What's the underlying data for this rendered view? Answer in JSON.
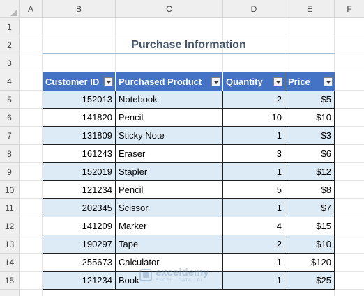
{
  "sheet": {
    "columns": [
      "A",
      "B",
      "C",
      "D",
      "E",
      "F"
    ],
    "rows": [
      "1",
      "2",
      "3",
      "4",
      "5",
      "6",
      "7",
      "8",
      "9",
      "10",
      "11",
      "12",
      "13",
      "14",
      "15"
    ]
  },
  "title": "Purchase Information",
  "table": {
    "headers": [
      "Customer ID",
      "Purchased Product",
      "Quantity",
      "Price"
    ],
    "rows": [
      [
        "152013",
        "Notebook",
        "2",
        "$5"
      ],
      [
        "141820",
        "Pencil",
        "10",
        "$10"
      ],
      [
        "131809",
        "Sticky Note",
        "1",
        "$3"
      ],
      [
        "161243",
        "Eraser",
        "3",
        "$6"
      ],
      [
        "152019",
        "Stapler",
        "1",
        "$12"
      ],
      [
        "121234",
        "Pencil",
        "5",
        "$8"
      ],
      [
        "202345",
        "Scissor",
        "1",
        "$7"
      ],
      [
        "141209",
        "Marker",
        "4",
        "$15"
      ],
      [
        "190297",
        "Tape",
        "2",
        "$10"
      ],
      [
        "255673",
        "Calculator",
        "1",
        "$120"
      ],
      [
        "121234",
        "Book",
        "1",
        "$25"
      ]
    ]
  },
  "watermark": {
    "name": "exceldemy",
    "tagline": "EXCEL · DATA · BI"
  },
  "colors": {
    "header_fill": "#4472c4",
    "band_fill": "#ddebf7",
    "title_text": "#44546a",
    "title_underline": "#9dc3e6"
  }
}
